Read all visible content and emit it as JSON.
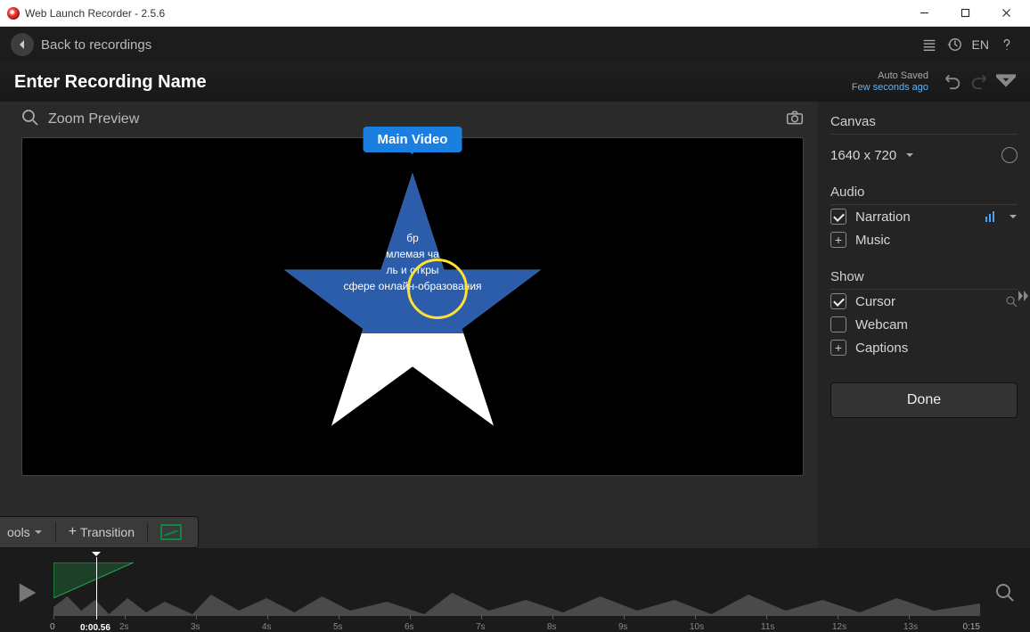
{
  "titlebar": {
    "title": "Web Launch Recorder - 2.5.6"
  },
  "topbar": {
    "back": "Back to recordings",
    "lang": "EN"
  },
  "namebar": {
    "name": "Enter Recording Name",
    "autosave_label": "Auto Saved",
    "autosave_time": "Few seconds ago"
  },
  "preview": {
    "zoom_label": "Zoom Preview",
    "main_badge": "Main Video",
    "lines": [
      "бр",
      "млемая ча",
      "ль и откры",
      "сфере онлайн-образования"
    ]
  },
  "panel": {
    "canvas": {
      "title": "Canvas",
      "value": "1640 x 720"
    },
    "audio": {
      "title": "Audio",
      "narration": "Narration",
      "music": "Music"
    },
    "show": {
      "title": "Show",
      "cursor": "Cursor",
      "webcam": "Webcam",
      "captions": "Captions"
    },
    "done": "Done"
  },
  "toolbar": {
    "tools": "ools",
    "transition": "Transition"
  },
  "timeline": {
    "current_time": "0:00.56",
    "start": "0",
    "ticks": [
      "2s",
      "3s",
      "4s",
      "5s",
      "6s",
      "7s",
      "8s",
      "9s",
      "10s",
      "11s",
      "12s",
      "13s"
    ],
    "end": "0:15"
  }
}
